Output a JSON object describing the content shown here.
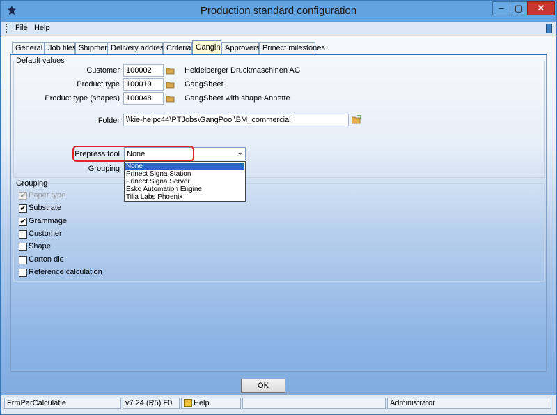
{
  "window": {
    "title": "Production standard configuration",
    "minimize": "–",
    "maximize": "▢",
    "close": "✕"
  },
  "menu": {
    "file": "File",
    "help": "Help"
  },
  "tabs": [
    "General",
    "Job files",
    "Shipment",
    "Delivery address",
    "Criteria",
    "Ganging",
    "Approvers",
    "Prinect milestones"
  ],
  "active_tab": "Ganging",
  "default_values": {
    "title": "Default values",
    "customer": {
      "label": "Customer",
      "value": "100002",
      "name": "Heidelberger Druckmaschinen AG"
    },
    "product_type": {
      "label": "Product type",
      "value": "100019",
      "name": "GangSheet"
    },
    "product_type_shapes": {
      "label": "Product type (shapes)",
      "value": "100048",
      "name": "GangSheet with shape  Annette"
    },
    "folder": {
      "label": "Folder",
      "value": "\\\\kie-heipc44\\PTJobs\\GangPool\\BM_commercial"
    },
    "prepress_tool": {
      "label": "Prepress tool",
      "value": "None"
    },
    "grouping_label": "Grouping"
  },
  "prepress_options": [
    "None",
    "Prinect Signa Station",
    "Prinect Signa Server",
    "Esko Automation Engine",
    "Tilia Labs Phoenix"
  ],
  "grouping": {
    "title": "Grouping",
    "items": [
      {
        "label": "Paper type",
        "checked": true,
        "mark": "✔",
        "disabled": true
      },
      {
        "label": "Substrate",
        "checked": true,
        "mark": "✔",
        "disabled": false
      },
      {
        "label": "Grammage",
        "checked": true,
        "mark": "✔",
        "disabled": false
      },
      {
        "label": "Customer",
        "checked": false,
        "mark": "",
        "disabled": false
      },
      {
        "label": "Shape",
        "checked": false,
        "mark": "",
        "disabled": false
      },
      {
        "label": "Carton die",
        "checked": false,
        "mark": "",
        "disabled": false
      },
      {
        "label": "Reference calculation",
        "checked": false,
        "mark": "",
        "disabled": false
      }
    ]
  },
  "ok_label": "OK",
  "statusbar": {
    "form": "FrmParCalculatie",
    "version": "v7.24 (R5) F0",
    "help": "Help",
    "user": "Administrator"
  },
  "colors": {
    "highlight": "#e0252b",
    "selection": "#2b65c8",
    "active_tab": "#fff8d8",
    "titlebar": "#63a4e0"
  }
}
